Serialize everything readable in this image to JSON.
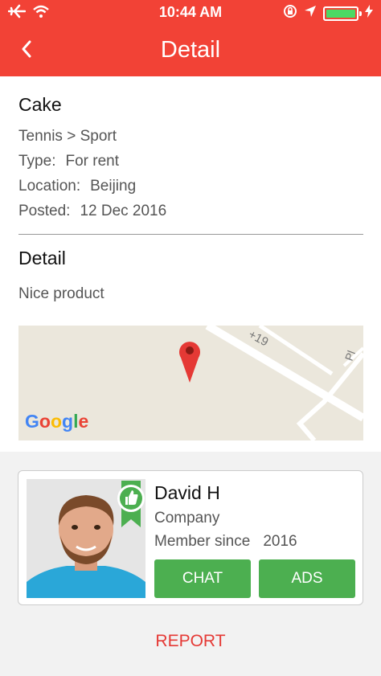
{
  "status_bar": {
    "time": "10:44 AM",
    "icons": [
      "airplane-icon",
      "wifi-icon",
      "orientation-lock-icon",
      "location-arrow-icon",
      "battery-icon"
    ],
    "battery_charge": 1.0
  },
  "nav": {
    "title": "Detail",
    "back_icon": "chevron-left-icon"
  },
  "product": {
    "name": "Cake",
    "category_path": "Tennis > Sport",
    "type_label": "Type:",
    "type_value": "For rent",
    "location_label": "Location:",
    "location_value": "Beijing",
    "posted_label": "Posted:",
    "posted_value": "12 Dec 2016"
  },
  "detail": {
    "heading": "Detail",
    "text": "Nice product"
  },
  "map": {
    "provider": "Google",
    "road_label_1": "+19",
    "road_label_2": "Pl",
    "marker_icon": "map-pin-icon"
  },
  "seller": {
    "name": "David H",
    "type": "Company",
    "member_label": "Member since",
    "member_year": "2016",
    "badge_icon": "thumbs-up-icon",
    "chat_label": "CHAT",
    "ads_label": "ADS"
  },
  "report_label": "REPORT",
  "colors": {
    "brand_red": "#f24236",
    "green": "#4caf50",
    "report_red": "#e53935"
  }
}
